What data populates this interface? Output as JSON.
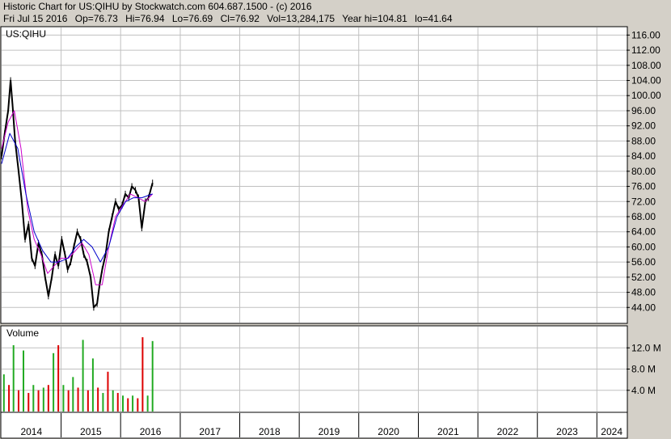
{
  "header": {
    "title": "Historic Chart for US:QIHU by Stockwatch.com 604.687.1500 - (c) 2016",
    "date": "Fri Jul 15 2016",
    "open": "Op=76.73",
    "high": "Hi=76.94",
    "low": "Lo=76.69",
    "close": "Cl=76.92",
    "volume": "Vol=13,284,175",
    "year_high": "Year hi=104.81",
    "year_low": "lo=41.64"
  },
  "colors": {
    "background": "#d4d0c8",
    "plot_bg": "#ffffff",
    "grid": "#c0c0c0",
    "price": "#000000",
    "ma_short": "#cc00cc",
    "ma_long": "#0000cc",
    "volume_up": "#22aa22",
    "volume_down": "#dd0000"
  },
  "chart_data": [
    {
      "type": "line",
      "title": "US:QIHU",
      "ylim": [
        40,
        118
      ],
      "y_ticks": [
        44,
        48,
        52,
        56,
        60,
        64,
        68,
        72,
        76,
        80,
        84,
        88,
        92,
        96,
        100,
        104,
        108,
        112,
        116
      ],
      "y_tick_labels": [
        "44.00",
        "48.00",
        "52.00",
        "56.00",
        "60.00",
        "64.00",
        "68.00",
        "72.00",
        "76.00",
        "80.00",
        "84.00",
        "88.00",
        "92.00",
        "96.00",
        "100.00",
        "104.00",
        "108.00",
        "112.00",
        "116.00"
      ],
      "x_tick_labels": [
        "2014",
        "2015",
        "2016",
        "2017",
        "2018",
        "2019",
        "2020",
        "2021",
        "2022",
        "2023",
        "2024"
      ],
      "xlim": [
        "2014-01-01",
        "2024-07-01"
      ],
      "grid": true,
      "series": [
        {
          "style": "price",
          "x": [
            "2014-01-01",
            "2014-01-20",
            "2014-02-10",
            "2014-02-25",
            "2014-03-10",
            "2014-03-25",
            "2014-04-15",
            "2014-05-05",
            "2014-05-25",
            "2014-06-15",
            "2014-07-05",
            "2014-07-25",
            "2014-08-15",
            "2014-09-05",
            "2014-09-25",
            "2014-10-15",
            "2014-11-05",
            "2014-11-25",
            "2014-12-15",
            "2015-01-05",
            "2015-01-25",
            "2015-02-10",
            "2015-03-01",
            "2015-03-20",
            "2015-04-10",
            "2015-05-01",
            "2015-05-20",
            "2015-06-10",
            "2015-07-01",
            "2015-07-20",
            "2015-08-10",
            "2015-08-25",
            "2015-09-10",
            "2015-10-01",
            "2015-10-20",
            "2015-11-10",
            "2015-12-01",
            "2015-12-20",
            "2016-01-10",
            "2016-01-30",
            "2016-02-20",
            "2016-03-10",
            "2016-04-01",
            "2016-04-20",
            "2016-05-10",
            "2016-06-01",
            "2016-06-20",
            "2016-07-15"
          ],
          "y": [
            84,
            90,
            96,
            104,
            97,
            88,
            80,
            72,
            62,
            66,
            57,
            55,
            61,
            58,
            52,
            47,
            52,
            58,
            55,
            62,
            58,
            54,
            56,
            60,
            64,
            62,
            58,
            56,
            52,
            44,
            45,
            50,
            54,
            58,
            64,
            68,
            72,
            70,
            71,
            74,
            73,
            76,
            75,
            73,
            65,
            72,
            73,
            76.92
          ]
        },
        {
          "style": "ma_short",
          "x": [
            "2014-01-01",
            "2014-02-10",
            "2014-03-20",
            "2014-04-30",
            "2014-06-10",
            "2014-07-20",
            "2014-08-30",
            "2014-10-10",
            "2014-11-20",
            "2015-01-01",
            "2015-02-15",
            "2015-03-30",
            "2015-05-10",
            "2015-06-20",
            "2015-08-01",
            "2015-09-10",
            "2015-10-20",
            "2015-12-01",
            "2016-01-15",
            "2016-03-01",
            "2016-04-15",
            "2016-06-01",
            "2016-07-15"
          ],
          "y": [
            86,
            93,
            96,
            86,
            70,
            62,
            58,
            53,
            55,
            57,
            57,
            59,
            61,
            58,
            50,
            50,
            60,
            68,
            71,
            74,
            73,
            72,
            74
          ]
        },
        {
          "style": "ma_long",
          "x": [
            "2014-01-01",
            "2014-02-20",
            "2014-04-10",
            "2014-05-30",
            "2014-07-20",
            "2014-09-10",
            "2014-10-30",
            "2014-12-20",
            "2015-02-10",
            "2015-04-01",
            "2015-05-20",
            "2015-07-10",
            "2015-08-30",
            "2015-10-20",
            "2015-12-10",
            "2016-02-01",
            "2016-03-20",
            "2016-05-10",
            "2016-07-15"
          ],
          "y": [
            82,
            90,
            86,
            74,
            64,
            59,
            56,
            56,
            57,
            60,
            62,
            60,
            56,
            60,
            68,
            72,
            73,
            73,
            74
          ]
        }
      ]
    },
    {
      "type": "bar",
      "title": "Volume",
      "ylim": [
        0,
        16
      ],
      "y_ticks": [
        4,
        8,
        12
      ],
      "y_tick_labels": [
        "4.0 M",
        "8.0 M",
        "12.0 M"
      ],
      "unit": "M",
      "x": [
        "2014-01-15",
        "2014-02-15",
        "2014-03-15",
        "2014-04-15",
        "2014-05-15",
        "2014-06-15",
        "2014-07-15",
        "2014-08-15",
        "2014-09-15",
        "2014-10-15",
        "2014-11-15",
        "2014-12-15",
        "2015-01-15",
        "2015-02-15",
        "2015-03-15",
        "2015-04-15",
        "2015-05-15",
        "2015-06-15",
        "2015-07-15",
        "2015-08-15",
        "2015-09-15",
        "2015-10-15",
        "2015-11-15",
        "2015-12-15",
        "2016-01-15",
        "2016-02-15",
        "2016-03-15",
        "2016-04-15",
        "2016-05-15",
        "2016-06-15",
        "2016-07-15"
      ],
      "values": [
        7,
        5,
        12.5,
        4,
        11.5,
        3.5,
        5,
        4,
        4.5,
        5,
        11,
        12.5,
        5,
        4,
        6.5,
        4.5,
        13.5,
        4,
        10,
        4.5,
        3.5,
        7.5,
        4,
        3.5,
        3,
        2.5,
        3,
        2.5,
        14,
        3,
        13.28
      ],
      "up": [
        true,
        false,
        true,
        false,
        true,
        false,
        true,
        false,
        true,
        false,
        true,
        false,
        true,
        false,
        true,
        false,
        true,
        false,
        true,
        false,
        true,
        false,
        true,
        false,
        true,
        false,
        true,
        false,
        false,
        true,
        true
      ]
    }
  ]
}
